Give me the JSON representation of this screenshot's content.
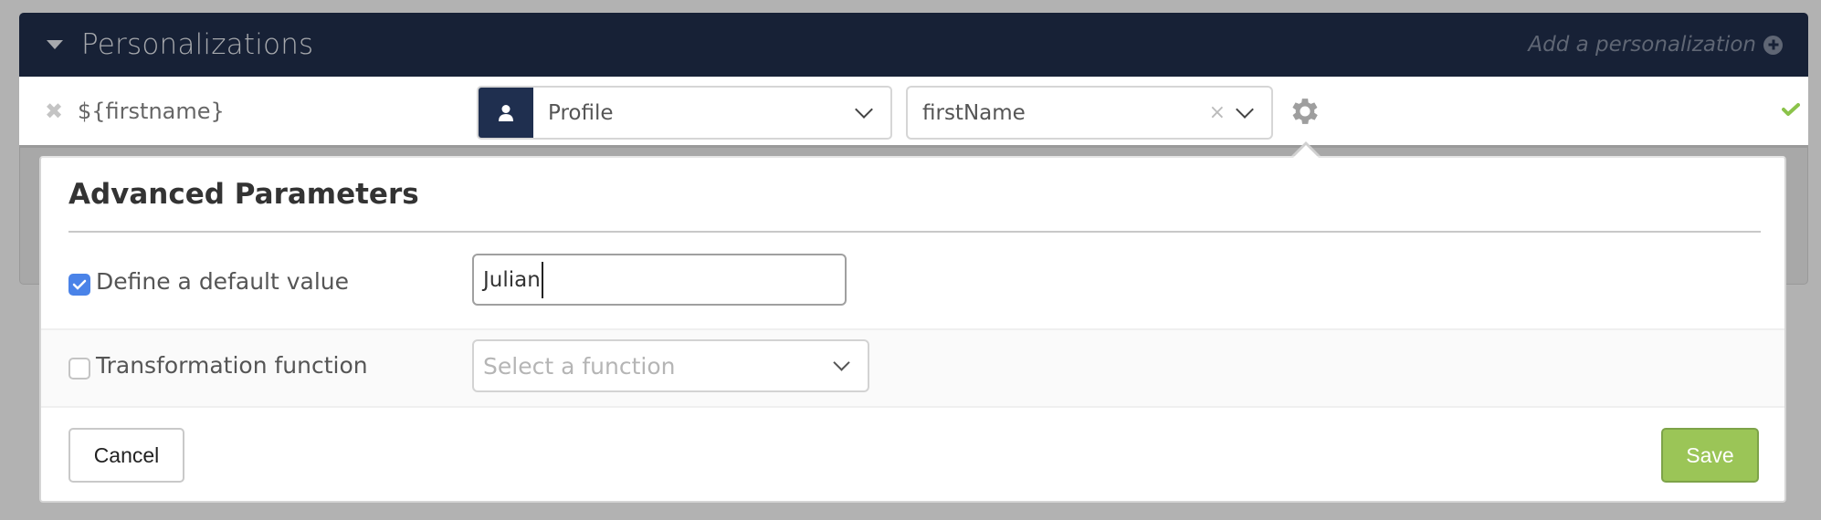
{
  "panel": {
    "title": "Personalizations",
    "add_link": "Add a personalization"
  },
  "personalization": {
    "variable": "${firstname}",
    "source_select": "Profile",
    "field_select": "firstName",
    "status": "valid"
  },
  "advanced": {
    "title": "Advanced Parameters",
    "default_value": {
      "label": "Define a default value",
      "checked": true,
      "value": "Julian"
    },
    "transformation": {
      "label": "Transformation function",
      "checked": false,
      "placeholder": "Select a function"
    },
    "cancel_label": "Cancel",
    "save_label": "Save"
  },
  "colors": {
    "header_bg": "#172136",
    "accent_blue": "#4a83e8",
    "save_green": "#9bc557",
    "check_green": "#8bc34a"
  }
}
